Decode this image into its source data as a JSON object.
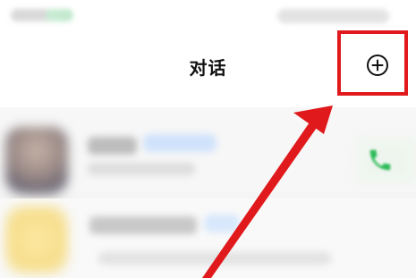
{
  "header": {
    "title": "对话"
  },
  "icons": {
    "add": "plus-circle-icon",
    "phone": "phone-icon"
  },
  "colors": {
    "annotation_red": "#e0191c",
    "phone_green": "#2dbb58"
  }
}
